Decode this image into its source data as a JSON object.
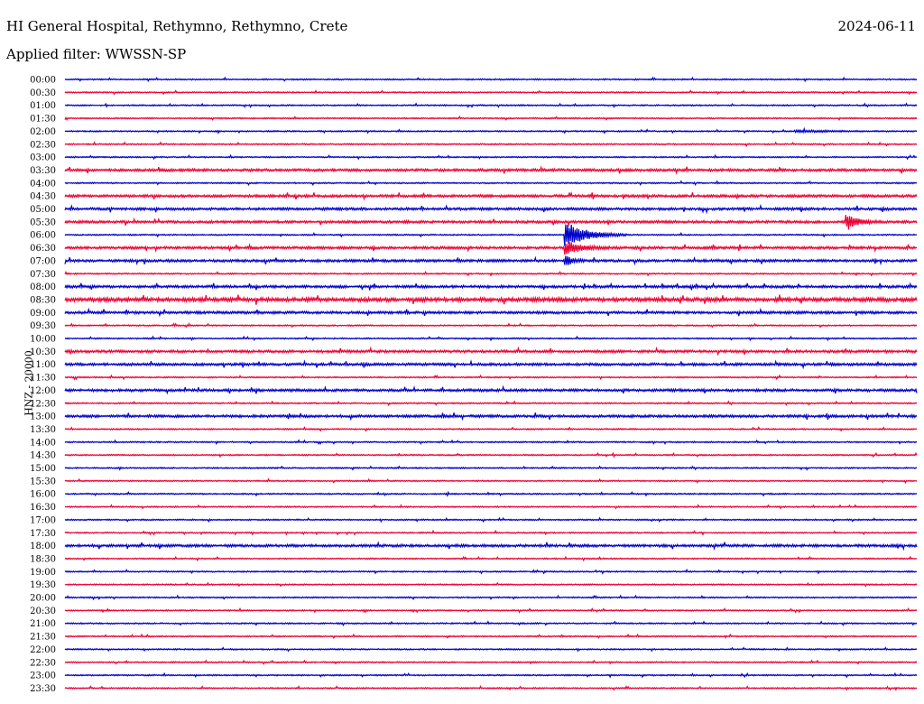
{
  "header": {
    "station": "HI General Hospital, Rethymno, Rethymno, Crete",
    "date": "2024-06-11",
    "filter": "Applied filter: WWSSN-SP"
  },
  "chart_data": {
    "type": "line",
    "title": "HI General Hospital, Rethymno, Rethymno, Crete",
    "ylabel": "HNZ - 20000",
    "grid": false,
    "colors": [
      "#0000cc",
      "#ee0033"
    ],
    "tick_labels": [
      "00:00",
      "00:30",
      "01:00",
      "01:30",
      "02:00",
      "02:30",
      "03:00",
      "03:30",
      "04:00",
      "04:30",
      "05:00",
      "05:30",
      "06:00",
      "06:30",
      "07:00",
      "07:30",
      "08:00",
      "08:30",
      "09:00",
      "09:30",
      "10:00",
      "10:30",
      "11:00",
      "11:30",
      "12:00",
      "12:30",
      "13:00",
      "13:30",
      "14:00",
      "14:30",
      "15:00",
      "15:30",
      "16:00",
      "16:30",
      "17:00",
      "17:30",
      "18:00",
      "18:30",
      "19:00",
      "19:30",
      "20:00",
      "20:30",
      "21:00",
      "21:30",
      "22:00",
      "22:30",
      "23:00",
      "23:30"
    ],
    "noise": [
      1,
      1,
      1,
      1,
      1,
      1,
      1,
      2,
      1,
      2,
      2,
      2,
      1,
      2,
      2,
      1,
      2,
      3,
      2,
      1,
      1,
      2,
      2,
      1,
      2,
      1,
      2,
      1,
      1,
      1,
      1,
      1,
      1,
      1,
      1,
      1,
      2,
      1,
      1,
      1,
      1,
      1,
      1,
      1,
      1,
      1,
      1,
      1
    ],
    "events": [
      {
        "row": 12,
        "at": 0.59,
        "amplitude": 26,
        "duration": 0.07,
        "label": ""
      },
      {
        "row": 11,
        "at": 0.92,
        "amplitude": 14,
        "duration": 0.04,
        "label": ""
      },
      {
        "row": 13,
        "at": 0.59,
        "amplitude": 14,
        "duration": 0.05,
        "label": ""
      },
      {
        "row": 14,
        "at": 0.59,
        "amplitude": 10,
        "duration": 0.02,
        "label": ""
      },
      {
        "row": 4,
        "at": 0.86,
        "amplitude": 2,
        "duration": 0.13,
        "label": ""
      }
    ]
  }
}
